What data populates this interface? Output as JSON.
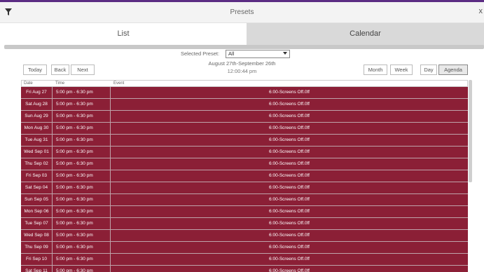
{
  "titlebar": {
    "title": "Presets",
    "close_label": "x"
  },
  "tabs": [
    {
      "label": "List"
    },
    {
      "label": "Calendar"
    }
  ],
  "preset": {
    "label": "Selected Preset:",
    "value": "All"
  },
  "header": {
    "date_range": "August 27th-September 26th",
    "time_now": "12:00:44 pm"
  },
  "nav": {
    "today": "Today",
    "back": "Back",
    "next": "Next"
  },
  "views": {
    "month": "Month",
    "week": "Week",
    "day": "Day",
    "agenda": "Agenda"
  },
  "table": {
    "columns": {
      "date": "Date",
      "time": "Time",
      "event": "Event"
    },
    "rows": [
      {
        "date": "Fri Aug 27",
        "time": "5:00 pm - 6:30 pm",
        "event": "6:00-Screens Off.0ff"
      },
      {
        "date": "Sat Aug 28",
        "time": "5:00 pm - 6:30 pm",
        "event": "6:00-Screens Off.0ff"
      },
      {
        "date": "Sun Aug 29",
        "time": "5:00 pm - 6:30 pm",
        "event": "6:00-Screens Off.0ff"
      },
      {
        "date": "Mon Aug 30",
        "time": "5:00 pm - 6:30 pm",
        "event": "6:00-Screens Off.0ff"
      },
      {
        "date": "Tue Aug 31",
        "time": "5:00 pm - 6:30 pm",
        "event": "6:00-Screens Off.0ff"
      },
      {
        "date": "Wed Sep 01",
        "time": "5:00 pm - 6:30 pm",
        "event": "6:00-Screens Off.0ff"
      },
      {
        "date": "Thu Sep 02",
        "time": "5:00 pm - 6:30 pm",
        "event": "6:00-Screens Off.0ff"
      },
      {
        "date": "Fri Sep 03",
        "time": "5:00 pm - 6:30 pm",
        "event": "6:00-Screens Off.0ff"
      },
      {
        "date": "Sat Sep 04",
        "time": "5:00 pm - 6:30 pm",
        "event": "6:00-Screens Off.0ff"
      },
      {
        "date": "Sun Sep 05",
        "time": "5:00 pm - 6:30 pm",
        "event": "6:00-Screens Off.0ff"
      },
      {
        "date": "Mon Sep 06",
        "time": "5:00 pm - 6:30 pm",
        "event": "6:00-Screens Off.0ff"
      },
      {
        "date": "Tue Sep 07",
        "time": "5:00 pm - 6:30 pm",
        "event": "6:00-Screens Off.0ff"
      },
      {
        "date": "Wed Sep 08",
        "time": "5:00 pm - 6:30 pm",
        "event": "6:00-Screens Off.0ff"
      },
      {
        "date": "Thu Sep 09",
        "time": "5:00 pm - 6:30 pm",
        "event": "6:00-Screens Off.0ff"
      },
      {
        "date": "Fri Sep 10",
        "time": "5:00 pm - 6:30 pm",
        "event": "6:00-Screens Off.0ff"
      },
      {
        "date": "Sat Sep 11",
        "time": "5:00 pm - 6:30 pm",
        "event": "6:00-Screens Off.0ff"
      }
    ]
  },
  "colors": {
    "accent": "#5b2c83",
    "event_bg": "#8b1f36",
    "tab_inactive": "#d9d9d9"
  }
}
